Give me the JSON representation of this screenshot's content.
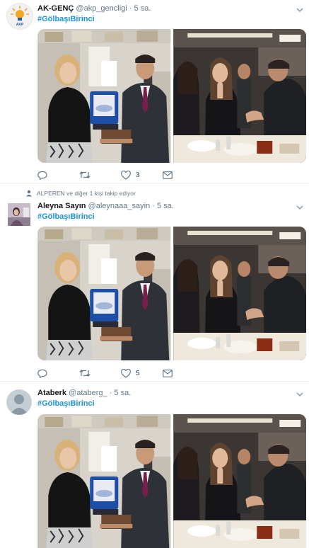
{
  "tweets": [
    {
      "name": "AK-GENÇ",
      "handle": "@akp_gencligi",
      "dot": "·",
      "time": "5 sa.",
      "hashtag": "#GölbaşıBirinci",
      "reply_count": "",
      "retweet_count": "",
      "like_count": "3",
      "social_context": ""
    },
    {
      "name": "Aleyna Sayın",
      "handle": "@aleynaaa_sayin",
      "dot": "·",
      "time": "5 sa.",
      "hashtag": "#GölbaşıBirinci",
      "reply_count": "",
      "retweet_count": "",
      "like_count": "5",
      "social_context": "ALPEREN ve diğer 1 kişi takip ediyor"
    },
    {
      "name": "Ataberk",
      "handle": "@ataberg_",
      "dot": "·",
      "time": "5 sa.",
      "hashtag": "#GölbaşıBirinci",
      "reply_count": "",
      "retweet_count": "",
      "like_count": "",
      "social_context": ""
    }
  ],
  "avatar_labels": {
    "akp": "AKP"
  },
  "icons": [
    "reply-icon",
    "retweet-icon",
    "like-icon",
    "message-icon",
    "caret-down-icon",
    "person-follow-icon"
  ],
  "colors": {
    "link": "#1b95e0",
    "muted": "#657786",
    "border": "#e6ecf0",
    "akp_orange": "#f5a623"
  }
}
